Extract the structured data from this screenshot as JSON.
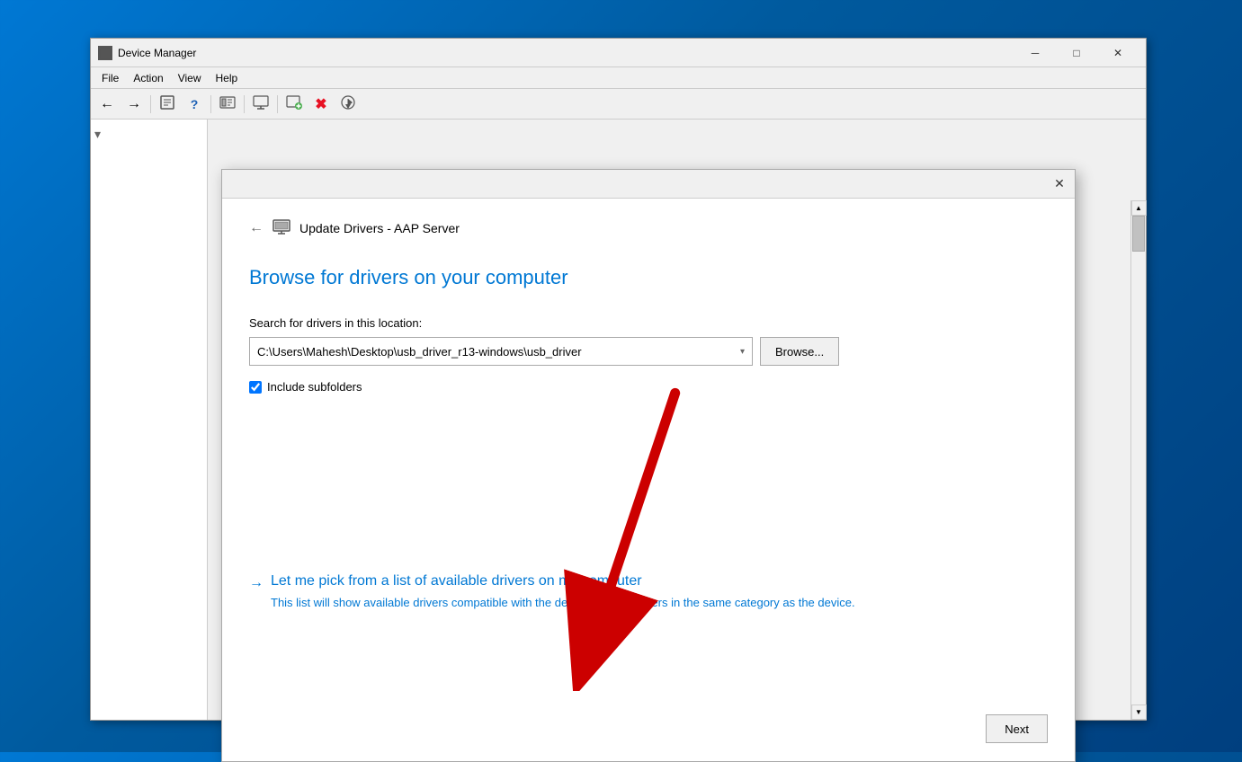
{
  "window": {
    "title": "Device Manager",
    "icon": "⚙",
    "minimize_label": "─",
    "maximize_label": "□",
    "close_label": "✕"
  },
  "menu": {
    "items": [
      "File",
      "Action",
      "View",
      "Help"
    ]
  },
  "toolbar": {
    "buttons": [
      {
        "name": "back",
        "icon": "←"
      },
      {
        "name": "forward",
        "icon": "→"
      },
      {
        "name": "properties",
        "icon": "📋"
      },
      {
        "name": "help",
        "icon": "?"
      },
      {
        "name": "show-hidden",
        "icon": "📊"
      },
      {
        "name": "monitor",
        "icon": "🖥"
      },
      {
        "name": "add",
        "icon": "➕"
      },
      {
        "name": "remove",
        "icon": "✖"
      },
      {
        "name": "update",
        "icon": "⬇"
      }
    ]
  },
  "dialog": {
    "close_label": "✕",
    "back_label": "←",
    "header_title": "Update Drivers - AAP Server",
    "main_title": "Browse for drivers on your computer",
    "location_label": "Search for drivers in this location:",
    "location_value": "C:\\Users\\Mahesh\\Desktop\\usb_driver_r13-windows\\usb_driver",
    "browse_label": "Browse...",
    "include_subfolders_label": "Include subfolders",
    "include_subfolders_checked": true,
    "link_arrow": "→",
    "main_link": "Let me pick from a list of available drivers on my computer",
    "link_description": "This list will show available drivers compatible with the device, and all drivers in the same category as the device.",
    "next_label": "Next"
  },
  "scrollbar": {
    "up_arrow": "▲",
    "down_arrow": "▼"
  }
}
